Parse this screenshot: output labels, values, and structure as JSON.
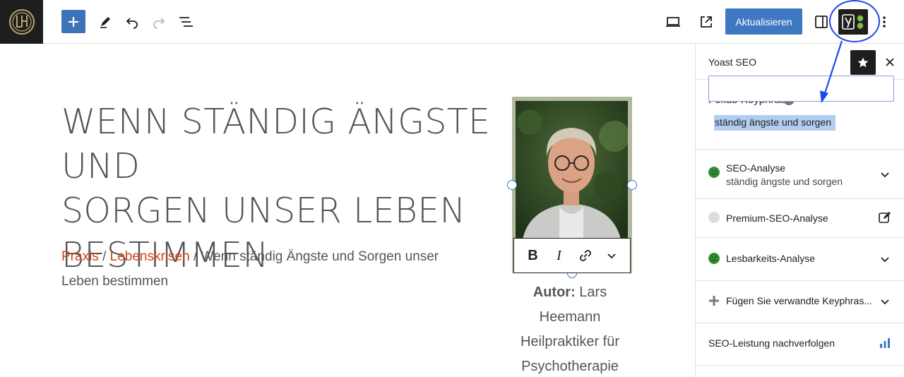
{
  "toolbar": {
    "update_label": "Aktualisieren",
    "icons": [
      "site-logo",
      "plus-icon",
      "pen-icon",
      "undo-icon",
      "redo-icon",
      "document-overview-icon",
      "desktop-preview-icon",
      "external-link-icon",
      "sidebar-toggle-icon",
      "yoast-icon",
      "more-options-icon"
    ]
  },
  "post": {
    "title": "WENN STÄNDIG ÄNGSTE UND\nSORGEN UNSER LEBEN\nBESTIMMEN",
    "breadcrumb": {
      "link1": "Praxis",
      "sep1": " / ",
      "link2": "Lebenskrisen",
      "sep2": " / ",
      "current": "Wenn ständig Ängste und Sorgen unser Leben bestimmen"
    },
    "author": {
      "label": "Autor:",
      "name": " Lars Heemann",
      "role": "Heilpraktiker für Psychotherapie"
    },
    "image_toolbar": {
      "bold": "B",
      "italic": "I"
    }
  },
  "sidebar": {
    "title": "Yoast SEO",
    "keyphrase_label": "Fokus-Keyphrase",
    "keyphrase_value": "ständig ängste und sorgen",
    "rows": [
      {
        "title": "SEO-Analyse",
        "subtitle": "ständig ängste und sorgen",
        "status": "good"
      },
      {
        "title": "Premium-SEO-Analyse",
        "status": "none"
      },
      {
        "title": "Lesbarkeits-Analyse",
        "status": "good"
      },
      {
        "title": "Fügen Sie verwandte Keyphras..."
      },
      {
        "title": "SEO-Leistung nachverfolgen"
      }
    ]
  },
  "colors": {
    "accent": "#3e78c1",
    "link": "#c8441c",
    "status_good": "#2f8a2f",
    "highlight": "#1f49e8"
  }
}
